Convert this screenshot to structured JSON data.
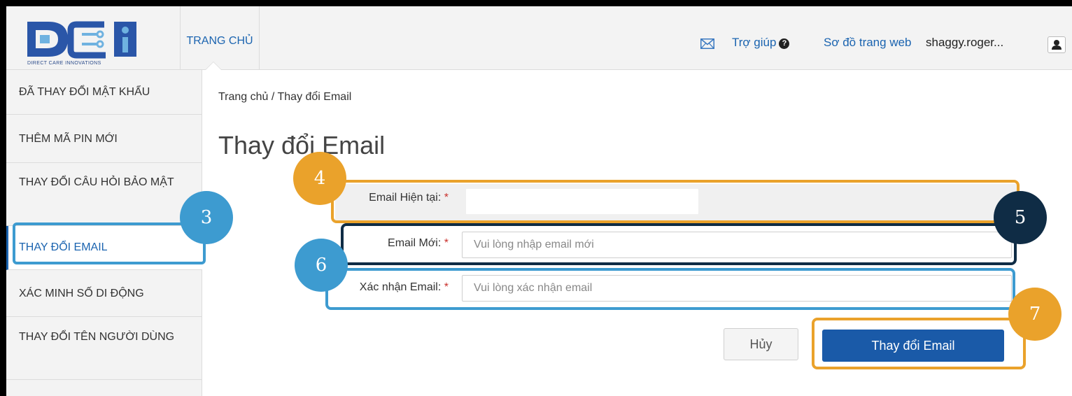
{
  "header": {
    "logo_text": "DCI",
    "logo_tagline": "DIRECT CARE INNOVATIONS",
    "nav_home": "TRANG CHỦ",
    "help_label": "Trợ giúp",
    "help_icon": "question-circle-icon",
    "sitemap_label": "Sơ đồ trang web",
    "username": "shaggy.roger...",
    "mail_icon": "envelope-icon",
    "user_icon": "user-icon"
  },
  "sidebar": {
    "items": [
      {
        "label": "ĐÃ THAY ĐỔI MẬT KHẨU",
        "active": false
      },
      {
        "label": "THÊM MÃ PIN MỚI",
        "active": false
      },
      {
        "label": "THAY ĐỔI CÂU HỎI BẢO MẬT",
        "active": false
      },
      {
        "label": "THAY ĐỔI EMAIL",
        "active": true
      },
      {
        "label": "XÁC MINH SỐ DI ĐỘNG",
        "active": false
      },
      {
        "label": "THAY ĐỔI TÊN NGƯỜI DÙNG",
        "active": false
      }
    ]
  },
  "main": {
    "breadcrumb": "Trang chủ / Thay đổi Email",
    "title": "Thay đổi Email",
    "form": {
      "current_email_label": "Email Hiện tại:",
      "current_email_value": "",
      "new_email_label": "Email Mới:",
      "new_email_placeholder": "Vui lòng nhập email mới",
      "confirm_email_label": "Xác nhận Email:",
      "confirm_email_placeholder": "Vui lòng xác nhận email",
      "required_mark": "*",
      "cancel_label": "Hủy",
      "submit_label": "Thay đổi Email"
    }
  },
  "annotations": [
    {
      "number": "3",
      "color": "#3d9bd0"
    },
    {
      "number": "4",
      "color": "#eaa22b"
    },
    {
      "number": "5",
      "color": "#0f2c45"
    },
    {
      "number": "6",
      "color": "#3d9bd0"
    },
    {
      "number": "7",
      "color": "#eaa22b"
    }
  ],
  "colors": {
    "link": "#1b64b0",
    "primary_button": "#1a5aa8",
    "required": "#c9302c"
  }
}
